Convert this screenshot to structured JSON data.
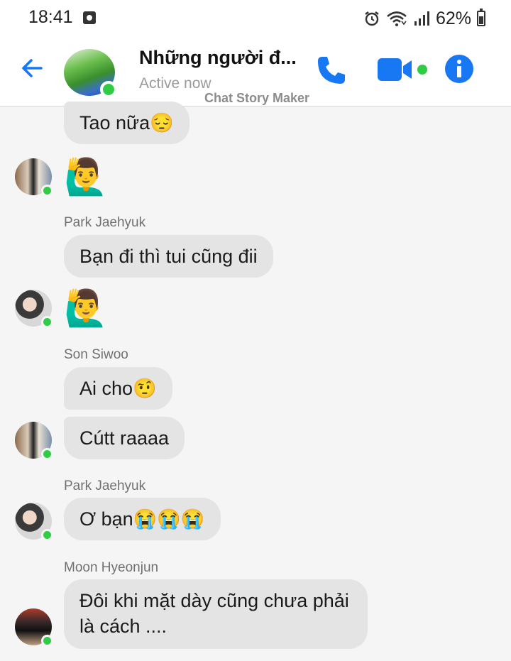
{
  "status_bar": {
    "time": "18:41",
    "battery": "62%"
  },
  "header": {
    "title": "Những người đ...",
    "subtitle": "Active now",
    "watermark": "Chat Story Maker",
    "accent_color": "#1877f2",
    "online_color": "#31cc46"
  },
  "messages": [
    {
      "type": "text",
      "text": "Tao nữa😔"
    },
    {
      "type": "emoji",
      "text": "🙋‍♂️"
    },
    {
      "type": "sender",
      "text": "Park Jaehyuk"
    },
    {
      "type": "text",
      "text": "Bạn đi thì tui cũng đii"
    },
    {
      "type": "emoji",
      "text": "🙋‍♂️"
    },
    {
      "type": "sender",
      "text": "Son Siwoo"
    },
    {
      "type": "text",
      "text": "Ai cho🤨"
    },
    {
      "type": "text",
      "text": "Cútt raaaa"
    },
    {
      "type": "sender",
      "text": "Park Jaehyuk"
    },
    {
      "type": "text",
      "text": "Ơ bạn😭😭😭"
    },
    {
      "type": "sender",
      "text": "Moon Hyeonjun"
    },
    {
      "type": "text",
      "line1": "Đôi khi mặt dày cũng chưa phải",
      "line2": "là cách ...."
    }
  ]
}
